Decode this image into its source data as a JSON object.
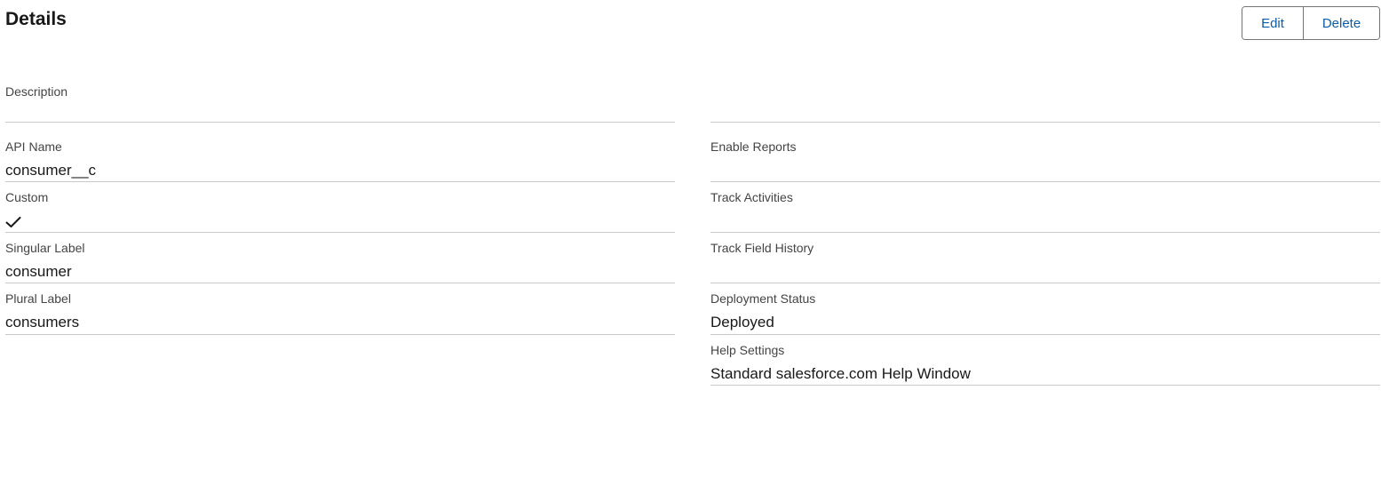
{
  "header": {
    "title": "Details",
    "edit_label": "Edit",
    "delete_label": "Delete"
  },
  "fields": {
    "description": {
      "label": "Description",
      "value": ""
    },
    "api_name": {
      "label": "API Name",
      "value": "consumer__c"
    },
    "custom": {
      "label": "Custom",
      "checked": true,
      "icon": "checkmark-icon"
    },
    "singular_label": {
      "label": "Singular Label",
      "value": "consumer"
    },
    "plural_label": {
      "label": "Plural Label",
      "value": "consumers"
    },
    "enable_reports": {
      "label": "Enable Reports",
      "value": ""
    },
    "track_activities": {
      "label": "Track Activities",
      "value": ""
    },
    "track_field_history": {
      "label": "Track Field History",
      "value": ""
    },
    "deployment_status": {
      "label": "Deployment Status",
      "value": "Deployed"
    },
    "help_settings": {
      "label": "Help Settings",
      "value": "Standard salesforce.com Help Window"
    }
  },
  "colors": {
    "button_text": "#0b5cab",
    "divider": "#c9c9c9",
    "label": "#444444"
  }
}
